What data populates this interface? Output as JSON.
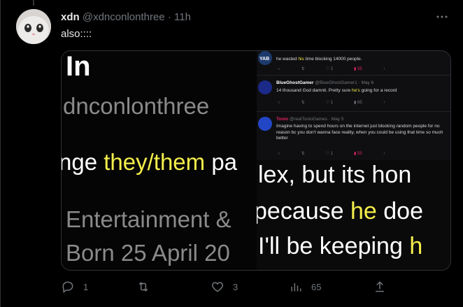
{
  "tweet": {
    "display_name": "xdn",
    "handle": "@xdnconlonthree",
    "separator": "·",
    "time": "11h",
    "text": "also::::",
    "more_icon": "more-icon",
    "actions": {
      "reply_count": "1",
      "retweet_count": "",
      "like_count": "3",
      "views_count": "65"
    }
  },
  "media": {
    "left": {
      "big": "In",
      "lines": [
        "dnconlonthree",
        "nge ",
        "they/them",
        " pa",
        "Entertainment &",
        "Born 25 April 20"
      ]
    },
    "embedded_tweets": [
      {
        "name": "",
        "handle": "",
        "text_pre": "he wasted ",
        "text_hl": "his",
        "text_post": " time blocking 14000 people.",
        "replies": "",
        "retweets": "",
        "likes": "2",
        "views": "55"
      },
      {
        "name": "BlueGhostGamer",
        "handle": "@BlueGhostGamer1 · May 6",
        "text_pre": "14 thousand God damnit. Pretty sure ",
        "text_hl": "he's",
        "text_post": " going for a record",
        "replies": "",
        "retweets": "",
        "likes": "1",
        "views": "65"
      },
      {
        "name": "Tonio",
        "handle": "@realTonioGames · May 5",
        "text_pre": "Imagine having to spend hours on the internet just blocking random people for no reason bc you don't wanna face reality, when you could be using that time so much better",
        "text_hl": "",
        "text_post": "",
        "replies": "",
        "retweets": "",
        "likes": "1",
        "views": "55"
      }
    ],
    "right": {
      "line1": "lex, but its hon",
      "line2_pre": "pecause ",
      "line2_hl": "he",
      "line2_post": " doe",
      "line3_pre": "I'll be keeping ",
      "line3_hl": "h"
    }
  },
  "colors": {
    "background": "#000000",
    "text": "#e7e9ea",
    "muted": "#71767b",
    "highlight": "#f4ee4b"
  }
}
